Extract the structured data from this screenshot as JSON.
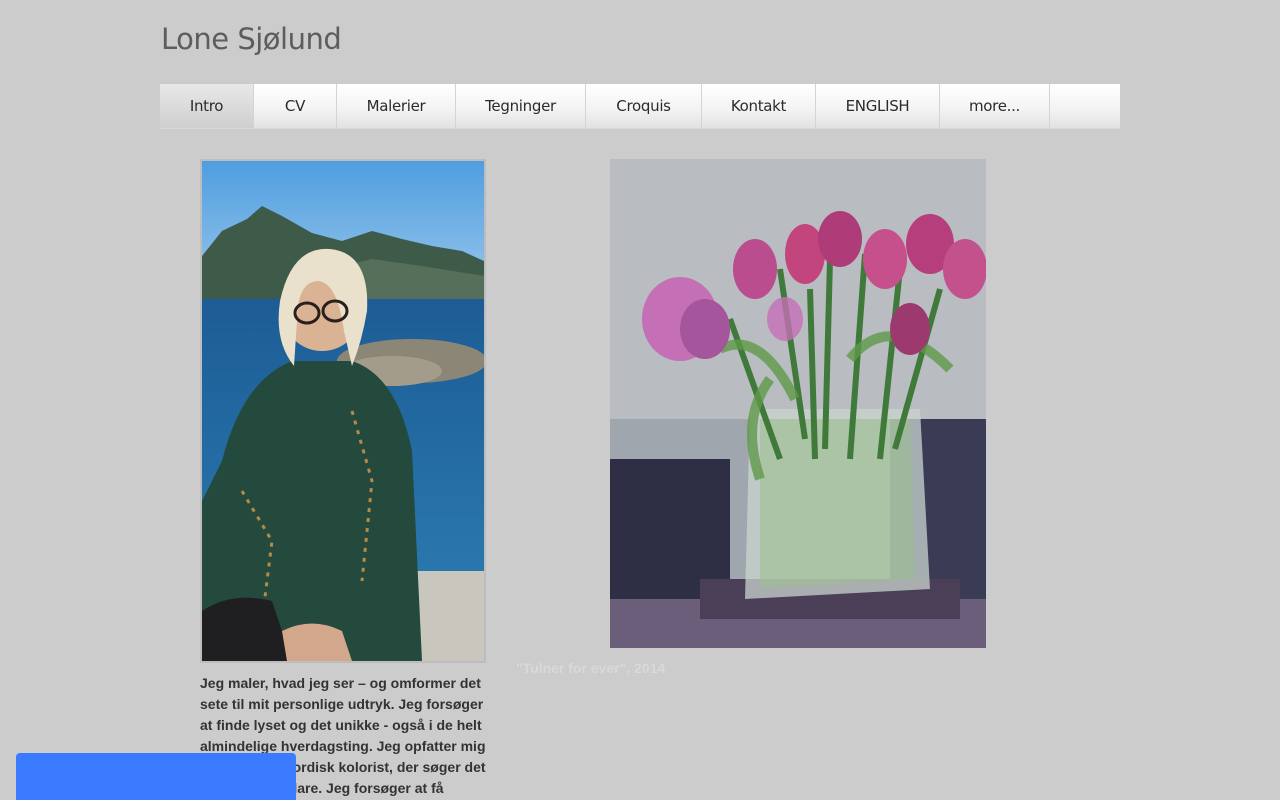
{
  "site": {
    "title": "Lone Sjølund"
  },
  "nav": {
    "items": [
      {
        "label": "Intro",
        "active": true
      },
      {
        "label": "CV"
      },
      {
        "label": "Malerier"
      },
      {
        "label": "Tegninger"
      },
      {
        "label": "Croquis"
      },
      {
        "label": "Kontakt"
      },
      {
        "label": "ENGLISH"
      },
      {
        "label": "more..."
      }
    ]
  },
  "main": {
    "painting_caption": "\"Tulner for ever\", 2014",
    "intro_text": "Jeg maler, hvad jeg ser – og omformer det sete til mit personlige udtryk. Jeg forsøger at finde lyset og det unikke - også i de helt almindelige hverdagsting. Jeg opfatter mig selv som en nordisk kolorist, der søger det enkle og det klare. Jeg forsøger at få"
  },
  "colors": {
    "background": "#cccccc",
    "title": "#5d5d5d",
    "cookie_bar": "#3a7bff"
  }
}
